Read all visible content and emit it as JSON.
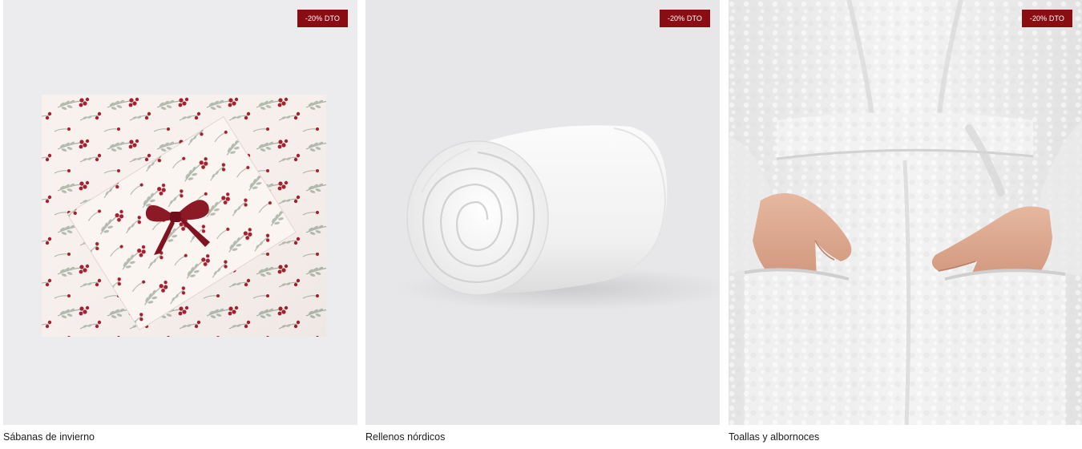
{
  "products": [
    {
      "badge": "-20% DTO",
      "title": "Sábanas de invierno",
      "icon": "winter-sheets-image"
    },
    {
      "badge": "-20% DTO",
      "title": "Rellenos nórdicos",
      "icon": "duvet-roll-image"
    },
    {
      "badge": "-20% DTO",
      "title": "Toallas y albornoces",
      "icon": "bathrobe-image"
    }
  ],
  "colors": {
    "badge_bg": "#8b0d14",
    "badge_text": "#ffffff",
    "caption_text": "#1c1c1c",
    "berry": "#a3202e",
    "leaf": "#9aa79a"
  }
}
